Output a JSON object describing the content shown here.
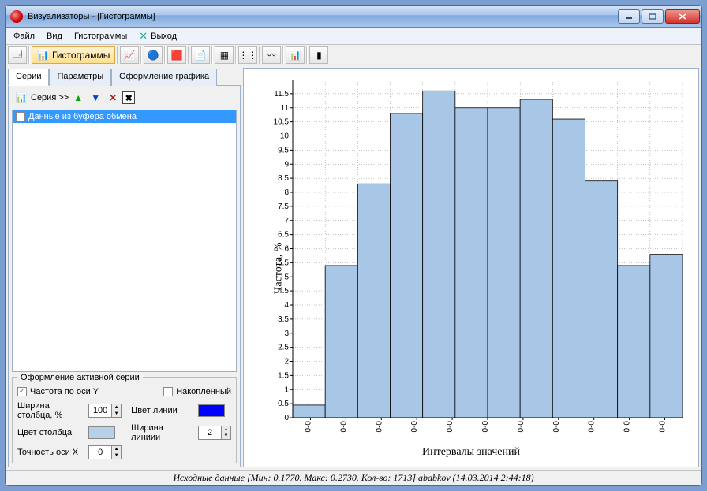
{
  "title": "Визуализаторы - [Гистограммы]",
  "menu": {
    "file": "Файл",
    "view": "Вид",
    "hist": "Гистограммы",
    "exit": "Выход"
  },
  "toolbar": {
    "hist_label": "Гистограммы"
  },
  "subtabs": {
    "series": "Серии",
    "params": "Параметры",
    "design": "Оформление графика"
  },
  "series_tool": {
    "label": "Серия >>"
  },
  "series_item": {
    "name": "Данные из буфера обмена",
    "checked": false
  },
  "activegroup": {
    "legend": "Оформление активной серии",
    "freqY": {
      "label": "Частота по оси Y",
      "checked": true
    },
    "accum": {
      "label": "Накопленный",
      "checked": false
    },
    "barwidth_label": "Ширина столбца, %",
    "barwidth": "100",
    "barcolor_label": "Цвет столбца",
    "barcolor": "#b8d0e8",
    "linecolor_label": "Цвет линии",
    "linecolor": "#0000ff",
    "linewidth_label": "Ширина линиии",
    "linewidth": "2",
    "xprec_label": "Точность оси X",
    "xprec": "0"
  },
  "status": "Исходные данные [Мин: 0.1770. Макс: 0.2730. Кол-во: 1713] ababkov (14.03.2014 2:44:18)",
  "chart_data": {
    "type": "bar",
    "ylabel": "Частота, %",
    "xlabel": "Интервалы значений",
    "categories": [
      "0-0",
      "0-0",
      "0-0",
      "0-0",
      "0-0",
      "0-0",
      "0-0",
      "0-0",
      "0-0",
      "0-0",
      "0-0"
    ],
    "values": [
      0.45,
      5.4,
      8.3,
      10.8,
      11.6,
      11.0,
      11.0,
      11.3,
      10.6,
      8.4,
      5.4,
      5.8
    ],
    "ylim": [
      0,
      12
    ],
    "yticks": [
      0,
      0.5,
      1,
      1.5,
      2,
      2.5,
      3,
      3.5,
      4,
      4.5,
      5,
      5.5,
      6,
      6.5,
      7,
      7.5,
      8,
      8.5,
      9,
      9.5,
      10,
      10.5,
      11,
      11.5
    ]
  }
}
